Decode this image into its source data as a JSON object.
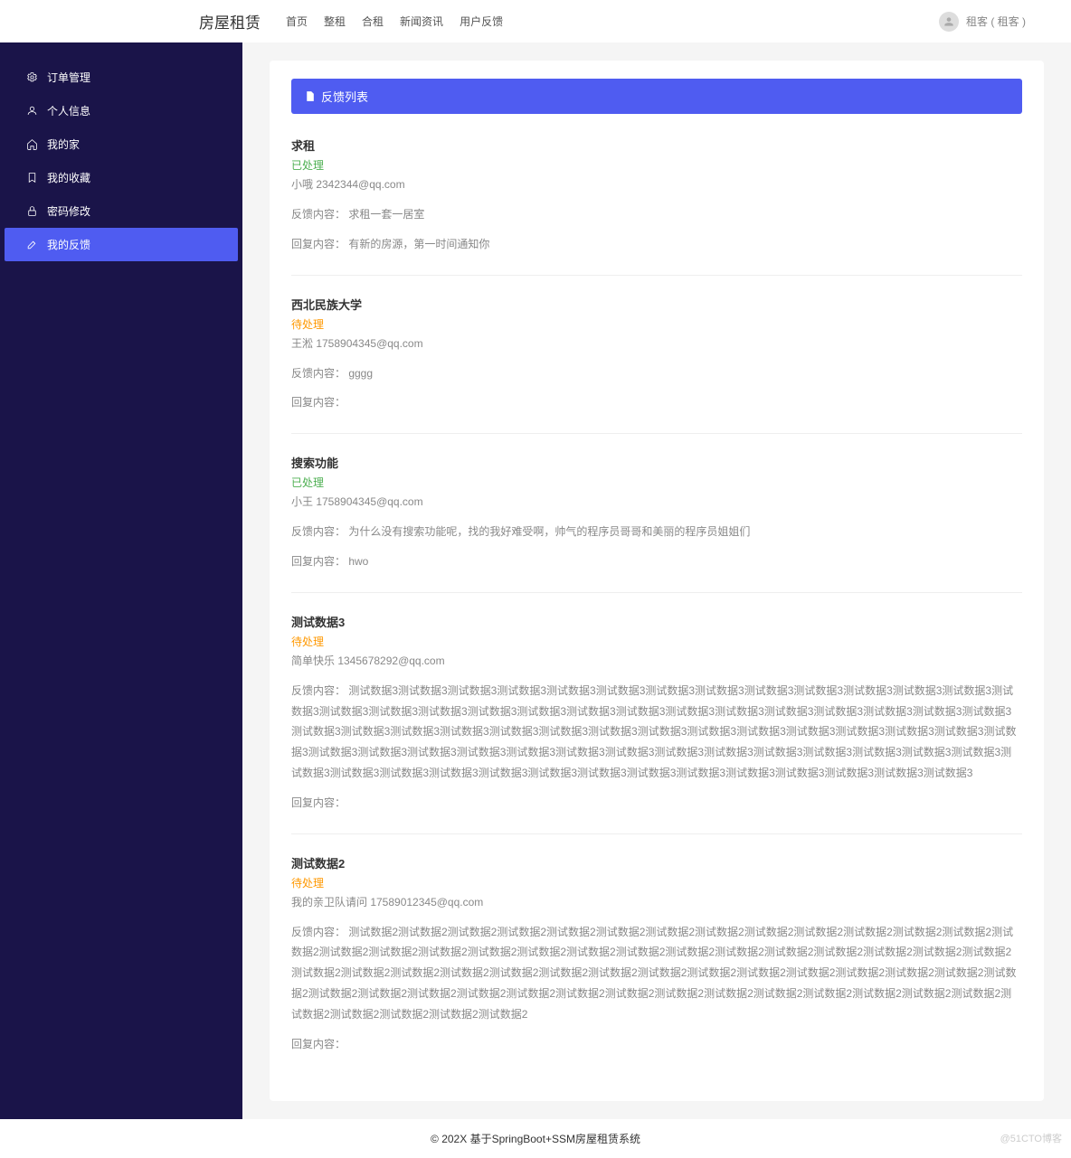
{
  "header": {
    "logo": "房屋租赁",
    "nav": [
      "首页",
      "整租",
      "合租",
      "新闻资讯",
      "用户反馈"
    ],
    "user_label": "租客 ( 租客 )"
  },
  "sidebar": {
    "items": [
      {
        "icon": "gear",
        "label": "订单管理"
      },
      {
        "icon": "user",
        "label": "个人信息"
      },
      {
        "icon": "home",
        "label": "我的家"
      },
      {
        "icon": "bookmark",
        "label": "我的收藏"
      },
      {
        "icon": "lock",
        "label": "密码修改"
      },
      {
        "icon": "edit",
        "label": "我的反馈",
        "active": true
      }
    ]
  },
  "panel": {
    "title": "反馈列表"
  },
  "labels": {
    "feedback_content": "反馈内容：",
    "reply_content": "回复内容："
  },
  "feedbacks": [
    {
      "title": "求租",
      "status": "已处理",
      "status_class": "done",
      "user": "小哦 2342344@qq.com",
      "content": "求租一套一居室",
      "reply": "有新的房源，第一时间通知你"
    },
    {
      "title": "西北民族大学",
      "status": "待处理",
      "status_class": "pending",
      "user": "王淞 1758904345@qq.com",
      "content": "gggg",
      "reply": ""
    },
    {
      "title": "搜索功能",
      "status": "已处理",
      "status_class": "done",
      "user": "小王 1758904345@qq.com",
      "content": "为什么没有搜索功能呢，找的我好难受啊，帅气的程序员哥哥和美丽的程序员姐姐们",
      "reply": "hwo"
    },
    {
      "title": "测试数据3",
      "status": "待处理",
      "status_class": "pending",
      "user": "简单快乐 1345678292@qq.com",
      "content": "测试数据3测试数据3测试数据3测试数据3测试数据3测试数据3测试数据3测试数据3测试数据3测试数据3测试数据3测试数据3测试数据3测试数据3测试数据3测试数据3测试数据3测试数据3测试数据3测试数据3测试数据3测试数据3测试数据3测试数据3测试数据3测试数据3测试数据3测试数据3测试数据3测试数据3测试数据3测试数据3测试数据3测试数据3测试数据3测试数据3测试数据3测试数据3测试数据3测试数据3测试数据3测试数据3测试数据3测试数据3测试数据3测试数据3测试数据3测试数据3测试数据3测试数据3测试数据3测试数据3测试数据3测试数据3测试数据3测试数据3测试数据3测试数据3测试数据3测试数据3测试数据3测试数据3测试数据3测试数据3测试数据3测试数据3测试数据3测试数据3测试数据3测试数据3测试数据3",
      "reply": ""
    },
    {
      "title": "测试数据2",
      "status": "待处理",
      "status_class": "pending",
      "user": "我的亲卫队请问 17589012345@qq.com",
      "content": "测试数据2测试数据2测试数据2测试数据2测试数据2测试数据2测试数据2测试数据2测试数据2测试数据2测试数据2测试数据2测试数据2测试数据2测试数据2测试数据2测试数据2测试数据2测试数据2测试数据2测试数据2测试数据2测试数据2测试数据2测试数据2测试数据2测试数据2测试数据2测试数据2测试数据2测试数据2测试数据2测试数据2测试数据2测试数据2测试数据2测试数据2测试数据2测试数据2测试数据2测试数据2测试数据2测试数据2测试数据2测试数据2测试数据2测试数据2测试数据2测试数据2测试数据2测试数据2测试数据2测试数据2测试数据2测试数据2测试数据2测试数据2测试数据2测试数据2测试数据2测试数据2测试数据2",
      "reply": ""
    }
  ],
  "footer": {
    "text": "© 202X 基于SpringBoot+SSM房屋租赁系统",
    "watermark": "@51CTO博客"
  }
}
